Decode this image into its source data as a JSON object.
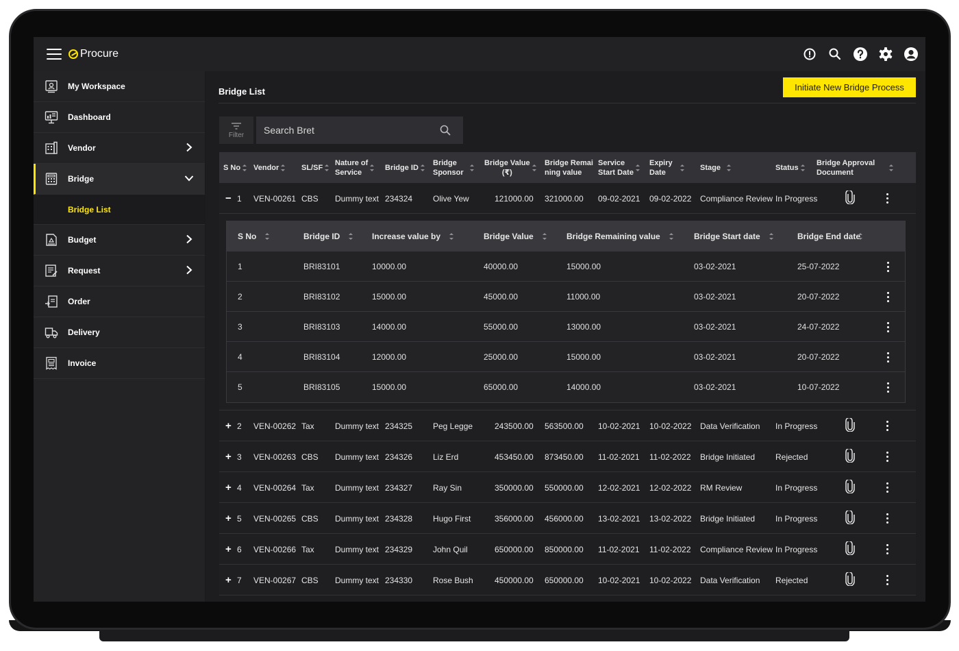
{
  "app": {
    "name": "Procure",
    "colors": {
      "accent": "#ffe600",
      "background": "#1d1d20",
      "header": "#333337"
    }
  },
  "topbar": {
    "icons": [
      "alert-icon",
      "search-icon",
      "help-icon",
      "settings-icon",
      "user-icon"
    ]
  },
  "sidebar": {
    "items": [
      {
        "label": "My Workspace",
        "icon": "workspace-icon"
      },
      {
        "label": "Dashboard",
        "icon": "dashboard-icon"
      },
      {
        "label": "Vendor",
        "icon": "vendor-icon",
        "chevron": "right"
      },
      {
        "label": "Bridge",
        "icon": "bridge-icon",
        "chevron": "down",
        "active": true
      },
      {
        "label": "Budget",
        "icon": "budget-icon",
        "chevron": "right"
      },
      {
        "label": "Request",
        "icon": "request-icon",
        "chevron": "right"
      },
      {
        "label": "Order",
        "icon": "order-icon"
      },
      {
        "label": "Delivery",
        "icon": "delivery-icon"
      },
      {
        "label": "Invoice",
        "icon": "invoice-icon"
      }
    ],
    "sub_item": "Bridge List"
  },
  "main": {
    "title": "Bridge List",
    "cta_label": "Initiate New Bridge Process",
    "filter_label": "Filter",
    "search_value": "Search Bret"
  },
  "table": {
    "headers": {
      "sno": "S No",
      "vendor": "Vendor",
      "slsf": "SL/SF",
      "nature_1": "Nature of",
      "nature_2": "Service",
      "bridge_id": "Bridge ID",
      "sponsor_1": "Bridge",
      "sponsor_2": "Sponsor",
      "value_1": "Bridge Value",
      "value_2": "(₹)",
      "remaining_1": "Bridge Remai",
      "remaining_2": "ning value",
      "start_1": "Service",
      "start_2": "Start Date",
      "expiry_1": "Expiry",
      "expiry_2": "Date",
      "stage": "Stage",
      "status": "Status",
      "doc_1": "Bridge Approval",
      "doc_2": "Document"
    },
    "rows": [
      {
        "toggle": "−",
        "sno": "1",
        "vendor": "VEN-00261",
        "slsf": "CBS",
        "nature": "Dummy text",
        "bridge_id": "234324",
        "sponsor": "Olive Yew",
        "value": "121000.00",
        "remaining": "321000.00",
        "start": "09-02-2021",
        "expiry": "09-02-2022",
        "stage": "Compliance Review",
        "status": "In Progress"
      },
      {
        "toggle": "+",
        "sno": "2",
        "vendor": "VEN-00262",
        "slsf": "Tax",
        "nature": "Dummy text",
        "bridge_id": "234325",
        "sponsor": "Peg Legge",
        "value": "243500.00",
        "remaining": "563500.00",
        "start": "10-02-2021",
        "expiry": "10-02-2022",
        "stage": "Data Verification",
        "status": "In Progress"
      },
      {
        "toggle": "+",
        "sno": "3",
        "vendor": "VEN-00263",
        "slsf": "CBS",
        "nature": "Dummy text",
        "bridge_id": "234326",
        "sponsor": "Liz Erd",
        "value": "453450.00",
        "remaining": "873450.00",
        "start": "11-02-2021",
        "expiry": "11-02-2022",
        "stage": "Bridge Initiated",
        "status": "Rejected"
      },
      {
        "toggle": "+",
        "sno": "4",
        "vendor": "VEN-00264",
        "slsf": "Tax",
        "nature": "Dummy text",
        "bridge_id": "234327",
        "sponsor": "Ray Sin",
        "value": "350000.00",
        "remaining": "550000.00",
        "start": "12-02-2021",
        "expiry": "12-02-2022",
        "stage": "RM Review",
        "status": "In Progress"
      },
      {
        "toggle": "+",
        "sno": "5",
        "vendor": "VEN-00265",
        "slsf": "CBS",
        "nature": "Dummy text",
        "bridge_id": "234328",
        "sponsor": "Hugo First",
        "value": "356000.00",
        "remaining": "456000.00",
        "start": "13-02-2021",
        "expiry": "13-02-2022",
        "stage": "Bridge Initiated",
        "status": "In Progress"
      },
      {
        "toggle": "+",
        "sno": "6",
        "vendor": "VEN-00266",
        "slsf": "Tax",
        "nature": "Dummy text",
        "bridge_id": "234329",
        "sponsor": "John Quil",
        "value": "650000.00",
        "remaining": "850000.00",
        "start": "11-02-2021",
        "expiry": "11-02-2022",
        "stage": "Compliance Review",
        "status": "In Progress"
      },
      {
        "toggle": "+",
        "sno": "7",
        "vendor": "VEN-00267",
        "slsf": "CBS",
        "nature": "Dummy text",
        "bridge_id": "234330",
        "sponsor": "Rose Bush",
        "value": "450000.00",
        "remaining": "650000.00",
        "start": "10-02-2021",
        "expiry": "10-02-2022",
        "stage": "Data Verification",
        "status": "Rejected"
      }
    ]
  },
  "nested": {
    "headers": {
      "sno": "S No",
      "bridge_id": "Bridge ID",
      "increase": "Increase value by",
      "value": "Bridge Value",
      "remaining": "Bridge Remaining value",
      "start": "Bridge Start date",
      "end": "Bridge End date"
    },
    "rows": [
      {
        "sno": "1",
        "bridge_id": "BRI83101",
        "increase": "10000.00",
        "value": "40000.00",
        "remaining": "15000.00",
        "start": "03-02-2021",
        "end": "25-07-2022"
      },
      {
        "sno": "2",
        "bridge_id": "BRI83102",
        "increase": "15000.00",
        "value": "45000.00",
        "remaining": "11000.00",
        "start": "03-02-2021",
        "end": "20-07-2022"
      },
      {
        "sno": "3",
        "bridge_id": "BRI83103",
        "increase": "14000.00",
        "value": "55000.00",
        "remaining": "13000.00",
        "start": "03-02-2021",
        "end": "24-07-2022"
      },
      {
        "sno": "4",
        "bridge_id": "BRI83104",
        "increase": "12000.00",
        "value": "25000.00",
        "remaining": "15000.00",
        "start": "03-02-2021",
        "end": "20-07-2022"
      },
      {
        "sno": "5",
        "bridge_id": "BRI83105",
        "increase": "15000.00",
        "value": "65000.00",
        "remaining": "14000.00",
        "start": "03-02-2021",
        "end": "10-07-2022"
      }
    ]
  }
}
